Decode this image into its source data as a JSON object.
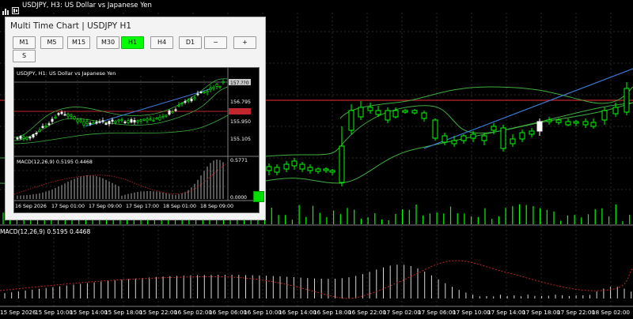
{
  "window": {
    "title": "USDJPY, H3:  US Dollar vs Japanese Yen",
    "icons": [
      "chart-bars-icon",
      "chart-candles-icon"
    ]
  },
  "panel": {
    "title": "Multi Time Chart  |  USDJPY H1",
    "timeframes": [
      {
        "label": "M1",
        "active": false
      },
      {
        "label": "M5",
        "active": false
      },
      {
        "label": "M15",
        "active": false
      },
      {
        "label": "M30",
        "active": false
      },
      {
        "label": "H1",
        "active": true
      },
      {
        "label": "H4",
        "active": false
      },
      {
        "label": "D1",
        "active": false
      },
      {
        "label": "−",
        "active": false
      },
      {
        "label": "+",
        "active": false
      }
    ],
    "second_row": [
      {
        "label": "S",
        "active": false
      }
    ],
    "mini_chart": {
      "title": "USDJPY, H1:  US Dollar vs Japanese Yen",
      "price_labels": [
        "157.??0",
        "156.795",
        "155.950",
        "155.105"
      ],
      "macd_label": "MACD(12,26,9) 0.5195 0.4468",
      "macd_scale": [
        "0.5771",
        "0.0000"
      ],
      "time_labels": [
        "16 Sep 2026",
        "17 Sep 01:00",
        "17 Sep 09:00",
        "17 Sep 17:00",
        "18 Sep 01:00",
        "18 Sep 09:00"
      ]
    }
  },
  "main_chart": {
    "macd_label": "MACD(12,26,9) 0.5195 0.4468",
    "time_labels": [
      "15 Sep 2026",
      "15 Sep 10:00",
      "15 Sep 14:00",
      "15 Sep 18:00",
      "15 Sep 22:00",
      "16 Sep 02:00",
      "16 Sep 06:00",
      "16 Sep 10:00",
      "16 Sep 14:00",
      "16 Sep 18:00",
      "16 Sep 22:00",
      "17 Sep 02:00",
      "17 Sep 06:00",
      "17 Sep 10:00",
      "17 Sep 14:00",
      "17 Sep 18:00",
      "17 Sep 22:00",
      "18 Sep 02:00"
    ]
  },
  "colors": {
    "bull": "#00ff00",
    "bear": "#ffffff",
    "band": "#3fae3f",
    "trend": "#3b7dd8",
    "redline": "#c0262c",
    "grid": "#2a2a2a",
    "macd_hist": "#d8d8d8",
    "macd_signal": "#c0262c",
    "active_button": "#00ff00"
  },
  "chart_data": [
    {
      "type": "candlestick",
      "title": "USDJPY, H3",
      "x": [
        "15 Sep 2026",
        "15 Sep 10:00",
        "15 Sep 14:00",
        "15 Sep 18:00",
        "15 Sep 22:00",
        "16 Sep 02:00",
        "16 Sep 06:00",
        "16 Sep 10:00",
        "16 Sep 14:00",
        "16 Sep 18:00",
        "16 Sep 22:00",
        "17 Sep 02:00",
        "17 Sep 06:00",
        "17 Sep 10:00",
        "17 Sep 14:00",
        "17 Sep 18:00",
        "17 Sep 22:00",
        "18 Sep 02:00"
      ],
      "series": [
        {
          "name": "MACD(12,26,9)",
          "values": [
            0.05,
            0.14,
            0.22,
            0.28,
            0.3,
            0.26,
            0.18,
            0.1,
            0.02,
            0.08,
            0.3,
            0.52,
            0.55,
            0.44,
            0.3,
            0.2,
            0.25,
            0.5
          ]
        },
        {
          "name": "Signal",
          "values": [
            0.02,
            0.08,
            0.15,
            0.22,
            0.26,
            0.26,
            0.23,
            0.18,
            0.12,
            0.1,
            0.16,
            0.3,
            0.42,
            0.44,
            0.4,
            0.32,
            0.28,
            0.45
          ]
        }
      ]
    },
    {
      "type": "candlestick",
      "title": "USDJPY, H1",
      "x": [
        "16 Sep 2026",
        "17 Sep 01:00",
        "17 Sep 09:00",
        "17 Sep 17:00",
        "18 Sep 01:00",
        "18 Sep 09:00"
      ],
      "ylim": [
        155.105,
        157.64
      ],
      "y_ticks": [
        155.105,
        155.95,
        156.795
      ],
      "series": [
        {
          "name": "MACD(12,26,9)",
          "values": [
            0.05,
            0.25,
            0.38,
            0.2,
            0.15,
            0.52
          ]
        },
        {
          "name": "Signal",
          "values": [
            0.03,
            0.18,
            0.32,
            0.25,
            0.18,
            0.45
          ]
        }
      ]
    }
  ]
}
